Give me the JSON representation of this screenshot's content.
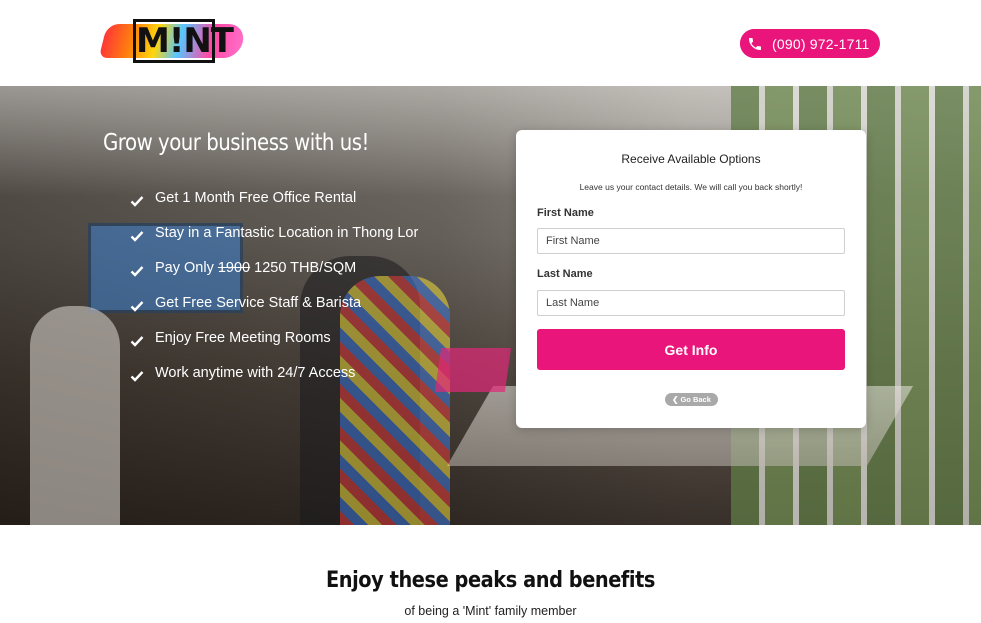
{
  "brand": {
    "logo_text": "M!NT",
    "accent_color": "#e9157b"
  },
  "header": {
    "phone": "(090) 972-1711"
  },
  "hero": {
    "title": "Grow your business with us!",
    "benefits": [
      {
        "text": "Get 1 Month Free Office Rental"
      },
      {
        "text": "Stay in a Fantastic Location in Thong Lor"
      },
      {
        "prefix": "Pay Only ",
        "old_price": "1900",
        "suffix": " 1250 THB/SQM"
      },
      {
        "text": "Get Free Service Staff & Barista"
      },
      {
        "text": "Enjoy Free Meeting Rooms"
      },
      {
        "text": "Work anytime with 24/7 Access"
      }
    ]
  },
  "form": {
    "title": "Receive Available Options",
    "subtitle": "Leave us your contact details. We will call you back shortly!",
    "first_name_label": "First Name",
    "first_name_placeholder": "First Name",
    "last_name_label": "Last Name",
    "last_name_placeholder": "Last Name",
    "submit_label": "Get Info",
    "back_label": "❮ Go Back"
  },
  "section": {
    "title": "Enjoy these peaks and benefits",
    "subtitle": "of being a 'Mint' family member"
  }
}
